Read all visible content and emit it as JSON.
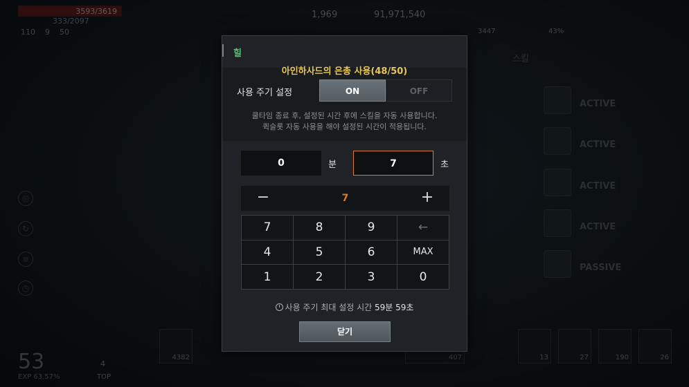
{
  "hud": {
    "hp_text": "3593/3619",
    "mp_text": "333/2097",
    "stat_a": "110",
    "stat_b": "9",
    "stat_c": "50",
    "currency_a": "1,969",
    "currency_b": "91,971,540",
    "count_a": "3447",
    "count_b": "43%",
    "level": "53",
    "exp": "EXP 63.57%",
    "top_label": "TOP",
    "top_value": "4"
  },
  "skill_panel": {
    "title": "스킬",
    "rows": [
      {
        "status": "ACTIVE"
      },
      {
        "status": "ACTIVE"
      },
      {
        "status": "ACTIVE"
      },
      {
        "status": "ACTIVE"
      },
      {
        "status": "PASSIVE"
      }
    ]
  },
  "quickbar": {
    "slots": [
      "4382",
      "407",
      "13",
      "27",
      "190",
      "26"
    ]
  },
  "modal": {
    "title": "힐",
    "usage": "아인하사드의 은총 사용(48/50)",
    "cycle_label": "사용 주기 설정",
    "toggle_on": "ON",
    "toggle_off": "OFF",
    "toggle_selected": "ON",
    "desc_line1": "쿨타임 종료 후, 설정된 시간 후에 스킬을 자동 사용합니다.",
    "desc_line2": "퀵슬롯 자동 사용을 해야 설정된 시간이 적용됩니다.",
    "minutes_value": "0",
    "minutes_unit": "분",
    "seconds_value": "7",
    "seconds_unit": "초",
    "stepper_value": "7",
    "stepper_minus": "−",
    "stepper_plus": "+",
    "keypad": [
      "7",
      "8",
      "9",
      "←",
      "4",
      "5",
      "6",
      "MAX",
      "1",
      "2",
      "3",
      "0"
    ],
    "max_note_prefix": "사용 주기 최대 설정 시간",
    "max_note_time": "59분 59초",
    "close_label": "닫기"
  },
  "colors": {
    "accent_orange": "#e07b2a",
    "title_green": "#4fc46b",
    "usage_gold": "#e8c75a"
  }
}
